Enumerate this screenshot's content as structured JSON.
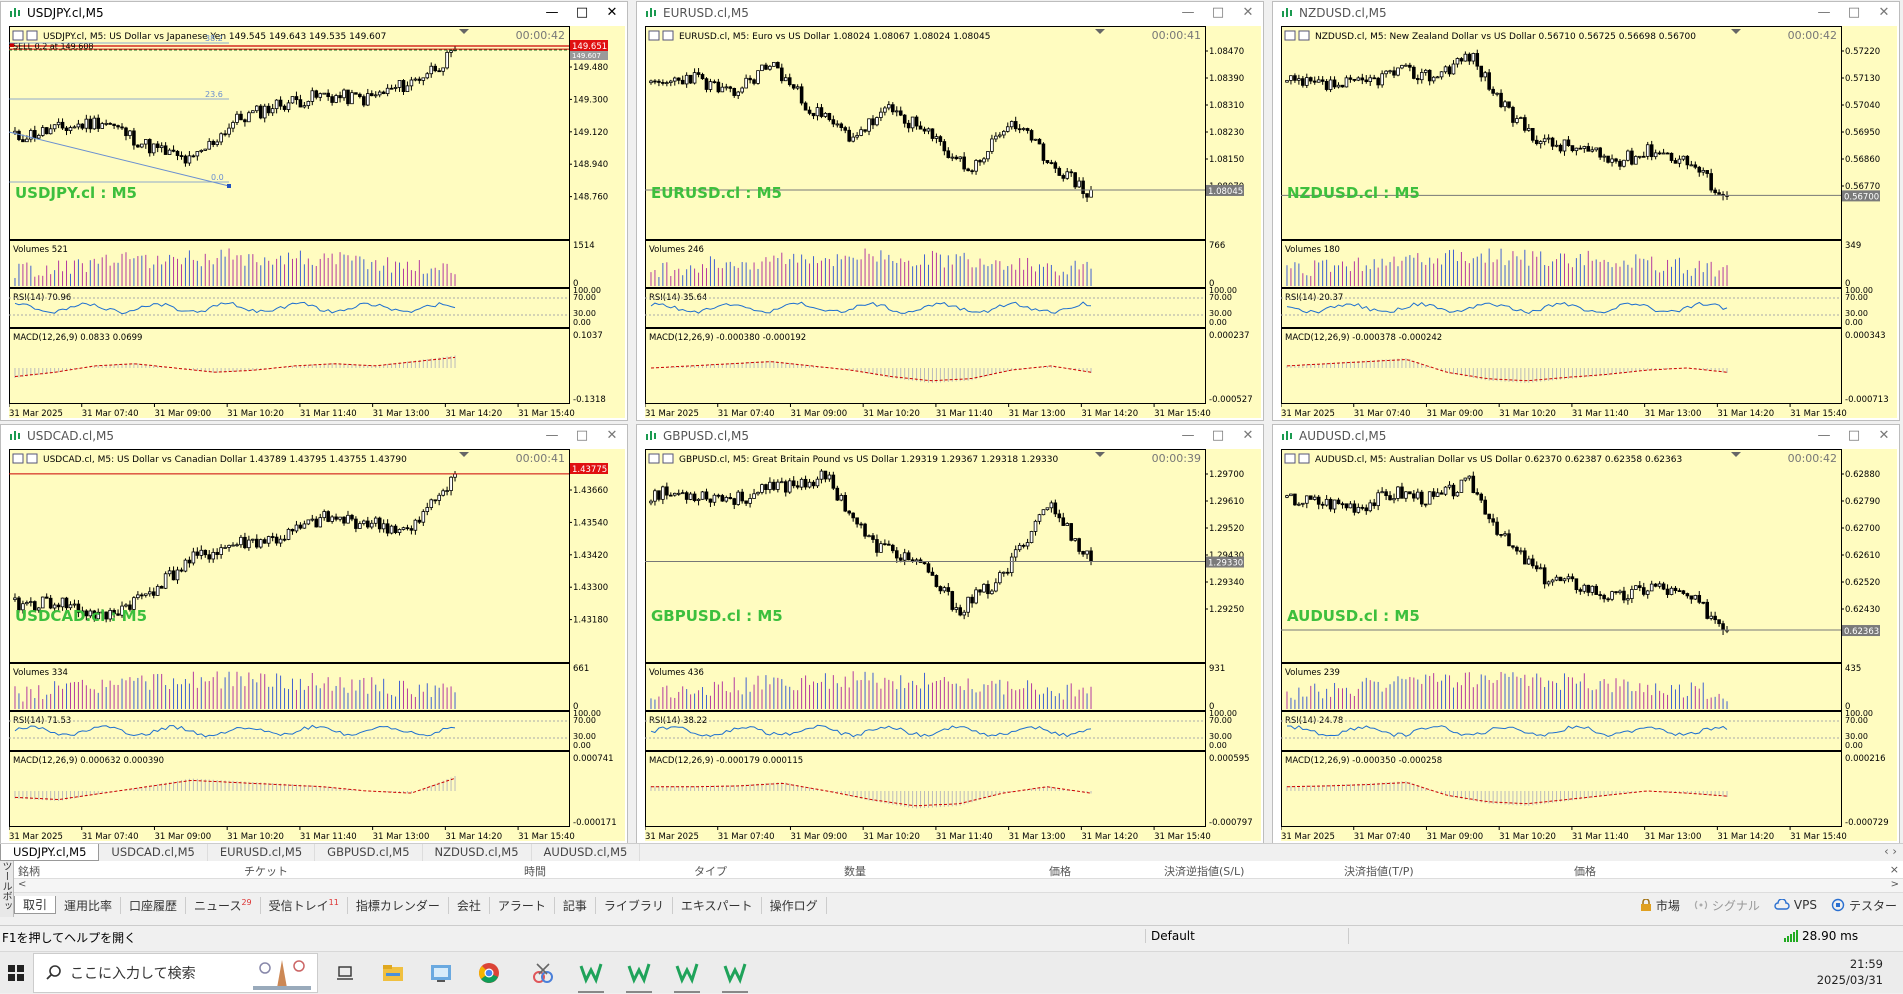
{
  "charts": [
    {
      "symbol": "USDJPY.cl,M5",
      "active": true,
      "info": "USDJPY.cl, M5:  US Dollar vs Japanese Yen  149.545 149.643 149.535 149.607",
      "timer": "00:00:42",
      "watermark": "USDJPY.cl : M5",
      "price_label": "149.651",
      "price_label2": "149.607",
      "price_label_color": "red",
      "axis": [
        "149.480",
        "149.300",
        "149.120",
        "148.940",
        "148.760"
      ],
      "order_text": "SELL 0.2 at 149.608",
      "fibo": [
        "38.2",
        "23.6",
        "0.0"
      ],
      "volumes": "Volumes 521",
      "vol_axis": [
        "1514",
        "0"
      ],
      "rsi": "RSI(14) 70.96",
      "macd": "MACD(12,26,9) 0.0833 0.0699",
      "macd_axis": [
        "0.1037",
        "-0.1318"
      ],
      "seed": 11,
      "trend": [
        0.45,
        0.5,
        0.55,
        0.4,
        0.3,
        0.55,
        0.65,
        0.7,
        0.68,
        0.78,
        0.95
      ],
      "macd_shape": [
        0.3,
        0.4,
        0.55,
        0.6,
        0.5,
        0.4,
        0.45,
        0.55,
        0.6,
        0.55,
        0.65,
        0.75
      ]
    },
    {
      "symbol": "EURUSD.cl,M5",
      "active": false,
      "info": "EURUSD.cl, M5:  Euro vs US Dollar  1.08024 1.08067 1.08024 1.08045",
      "timer": "00:00:41",
      "watermark": "EURUSD.cl : M5",
      "price_label": "1.08045",
      "price_label_color": "gray",
      "axis": [
        "1.08470",
        "1.08390",
        "1.08310",
        "1.08230",
        "1.08150",
        "1.08070"
      ],
      "volumes": "Volumes 246",
      "vol_axis": [
        "766",
        "0"
      ],
      "rsi": "RSI(14) 35.64",
      "macd": "MACD(12,26,9) -0.000380 -0.000192",
      "macd_axis": [
        "0.000237",
        "-0.000527"
      ],
      "seed": 23,
      "trend": [
        0.75,
        0.82,
        0.7,
        0.9,
        0.62,
        0.45,
        0.62,
        0.45,
        0.25,
        0.55,
        0.3,
        0.1
      ],
      "macd_shape": [
        0.5,
        0.55,
        0.6,
        0.65,
        0.55,
        0.45,
        0.3,
        0.2,
        0.25,
        0.45,
        0.55,
        0.4
      ]
    },
    {
      "symbol": "NZDUSD.cl,M5",
      "active": false,
      "info": "NZDUSD.cl, M5:  New Zealand Dollar vs US Dollar  0.56710 0.56725 0.56698 0.56700",
      "timer": "00:00:42",
      "watermark": "NZDUSD.cl : M5",
      "price_label": "0.56700",
      "price_label_color": "gray",
      "axis": [
        "0.57220",
        "0.57130",
        "0.57040",
        "0.56950",
        "0.56860",
        "0.56770"
      ],
      "volumes": "Volumes 180",
      "vol_axis": [
        "349",
        "0"
      ],
      "rsi": "RSI(14) 20.37",
      "macd": "MACD(12,26,9) -0.000378 -0.000242",
      "macd_axis": [
        "0.000343",
        "-0.000713"
      ],
      "seed": 37,
      "trend": [
        0.78,
        0.76,
        0.77,
        0.85,
        0.82,
        0.95,
        0.6,
        0.42,
        0.38,
        0.3,
        0.38,
        0.3,
        0.08
      ],
      "macd_shape": [
        0.55,
        0.6,
        0.65,
        0.7,
        0.4,
        0.25,
        0.2,
        0.28,
        0.35,
        0.45,
        0.5,
        0.4
      ]
    },
    {
      "symbol": "USDCAD.cl,M5",
      "active": false,
      "info": "USDCAD.cl, M5:  US Dollar vs Canadian Dollar  1.43789 1.43795 1.43755 1.43790",
      "timer": "00:00:41",
      "watermark": "USDCAD.cl : M5",
      "price_label": "1.43775",
      "price_label_color": "red",
      "axis": [
        "1.43660",
        "1.43540",
        "1.43420",
        "1.43300",
        "1.43180"
      ],
      "volumes": "Volumes 334",
      "vol_axis": [
        "661",
        "0"
      ],
      "rsi": "RSI(14) 71.53",
      "macd": "MACD(12,26,9) 0.000632 0.000390",
      "macd_axis": [
        "0.000741",
        "-0.000171"
      ],
      "seed": 41,
      "trend": [
        0.18,
        0.2,
        0.1,
        0.25,
        0.45,
        0.55,
        0.58,
        0.7,
        0.68,
        0.62,
        0.98
      ],
      "macd_shape": [
        0.35,
        0.3,
        0.45,
        0.6,
        0.75,
        0.7,
        0.65,
        0.6,
        0.5,
        0.45,
        0.8
      ]
    },
    {
      "symbol": "GBPUSD.cl,M5",
      "active": false,
      "info": "GBPUSD.cl, M5:  Great Britain Pound vs US Dollar  1.29319 1.29367 1.29318 1.29330",
      "timer": "00:00:39",
      "watermark": "GBPUSD.cl : M5",
      "price_label": "1.29330",
      "price_label_color": "gray",
      "axis": [
        "1.29700",
        "1.29610",
        "1.29520",
        "1.29430",
        "1.29340",
        "1.29250"
      ],
      "volumes": "Volumes 436",
      "vol_axis": [
        "931",
        "0"
      ],
      "rsi": "RSI(14) 38.22",
      "macd": "MACD(12,26,9) -0.000179 0.000115",
      "macd_axis": [
        "0.000595",
        "-0.000797"
      ],
      "seed": 53,
      "trend": [
        0.85,
        0.85,
        0.82,
        0.9,
        0.95,
        0.55,
        0.45,
        0.15,
        0.35,
        0.8,
        0.45
      ],
      "macd_shape": [
        0.6,
        0.6,
        0.62,
        0.68,
        0.5,
        0.3,
        0.15,
        0.2,
        0.45,
        0.6,
        0.45
      ]
    },
    {
      "symbol": "AUDUSD.cl,M5",
      "active": false,
      "info": "AUDUSD.cl, M5:  Australian Dollar vs US Dollar  0.62370 0.62387 0.62358 0.62363",
      "timer": "00:00:42",
      "watermark": "AUDUSD.cl : M5",
      "price_label": "0.62363",
      "price_label_color": "gray",
      "axis": [
        "0.62880",
        "0.62790",
        "0.62700",
        "0.62610",
        "0.62520",
        "0.62430"
      ],
      "volumes": "Volumes 239",
      "vol_axis": [
        "435",
        "0"
      ],
      "rsi": "RSI(14) 24.78",
      "macd": "MACD(12,26,9) -0.000350 -0.000258",
      "macd_axis": [
        "0.000216",
        "-0.000729"
      ],
      "seed": 67,
      "trend": [
        0.82,
        0.8,
        0.78,
        0.86,
        0.82,
        0.92,
        0.55,
        0.35,
        0.3,
        0.22,
        0.3,
        0.22,
        0.05
      ],
      "macd_shape": [
        0.6,
        0.62,
        0.65,
        0.7,
        0.4,
        0.25,
        0.2,
        0.3,
        0.4,
        0.5,
        0.45,
        0.38
      ]
    }
  ],
  "rsi_axis": [
    "100.00",
    "70.00",
    "30.00",
    "0.00"
  ],
  "time_axis": [
    "31 Mar 2025",
    "31 Mar 07:40",
    "31 Mar 09:00",
    "31 Mar 10:20",
    "31 Mar 11:40",
    "31 Mar 13:00",
    "31 Mar 14:20",
    "31 Mar 15:40"
  ],
  "chart_tabs": [
    "USDJPY.cl,M5",
    "USDCAD.cl,M5",
    "EURUSD.cl,M5",
    "GBPUSD.cl,M5",
    "NZDUSD.cl,M5",
    "AUDUSD.cl,M5"
  ],
  "terminal": {
    "side_label": "ツールボックス",
    "headers": [
      "銘柄",
      "チケット",
      "時間",
      "タイプ",
      "数量",
      "価格",
      "決済逆指値(S/L)",
      "決済指値(T/P)",
      "価格"
    ],
    "tabs": [
      {
        "label": "取引",
        "active": true
      },
      {
        "label": "運用比率"
      },
      {
        "label": "口座履歴"
      },
      {
        "label": "ニュース",
        "badge": "29"
      },
      {
        "label": "受信トレイ",
        "badge": "11"
      },
      {
        "label": "指標カレンダー"
      },
      {
        "label": "会社"
      },
      {
        "label": "アラート"
      },
      {
        "label": "記事"
      },
      {
        "label": "ライブラリ"
      },
      {
        "label": "エキスパート"
      },
      {
        "label": "操作ログ"
      }
    ],
    "right": [
      {
        "label": "市場",
        "icon": "lock-icon"
      },
      {
        "label": "シグナル",
        "icon": "signal-icon",
        "dim": true
      },
      {
        "label": "VPS",
        "icon": "cloud-icon"
      },
      {
        "label": "テスター",
        "icon": "tester-icon"
      }
    ]
  },
  "status": {
    "help": "F1を押してヘルプを開く",
    "profile": "Default",
    "ping": "28.90 ms"
  },
  "taskbar": {
    "search_placeholder": "ここに入力して検索",
    "time": "21:59",
    "date": "2025/03/31"
  }
}
